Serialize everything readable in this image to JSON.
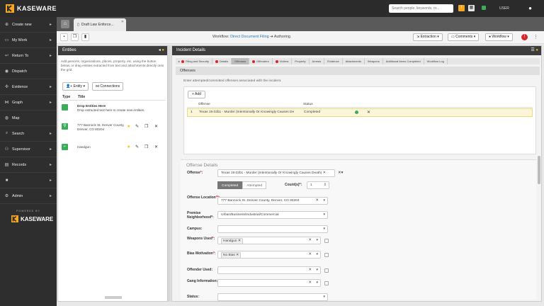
{
  "topbar": {
    "brand": "KASEWARE",
    "search_placeholder": "Search people, keywords, or...",
    "user": "USER"
  },
  "sidebar": {
    "items": [
      {
        "label": "Create new",
        "icon": "plus-icon"
      },
      {
        "label": "My Work",
        "icon": "folder-icon"
      },
      {
        "label": "Return To",
        "icon": "return-icon"
      },
      {
        "label": "Dispatch",
        "icon": "dispatch-icon"
      },
      {
        "label": "Evidence",
        "icon": "evidence-icon"
      },
      {
        "label": "Graph",
        "icon": "graph-icon"
      },
      {
        "label": "Map",
        "icon": "map-icon"
      },
      {
        "label": "Search",
        "icon": "search-icon"
      },
      {
        "label": "Supervisor",
        "icon": "supervisor-icon"
      },
      {
        "label": "Records",
        "icon": "records-icon"
      },
      {
        "label": "",
        "icon": "box-icon"
      },
      {
        "label": "Admin",
        "icon": "gear-icon"
      }
    ],
    "powered_by": "POWERED BY",
    "brand": "KASEWARE"
  },
  "tabs": {
    "doc_tab": "Draft Law Enforce..."
  },
  "toolbar": {
    "workflow_prefix": "Workflow:",
    "workflow_link": "Direct Document Filing",
    "workflow_arrow": "➔",
    "workflow_state": "Authoring",
    "extraction": "Extraction",
    "comments": "Comments",
    "workflow": "Workflow"
  },
  "entities": {
    "title": "Entities",
    "description": "Add persons, organizations, places, property, etc. using the button below, or drag entities extracted from text and attachments directly onto the grid.",
    "entity_btn": "Entity",
    "connections_btn": "Connections",
    "col_type": "Type",
    "col_title": "Title",
    "drop_title": "Drop Entities Here",
    "drop_desc": "Drop extracted text here to create new entities.",
    "rows": [
      {
        "title": "777 Bannock St. Denver County, Denver, CO 80204"
      },
      {
        "title": "Handgun"
      }
    ]
  },
  "incident": {
    "title": "Incident Details",
    "steps": [
      {
        "label": "Filing and Security",
        "error": true
      },
      {
        "label": "Details",
        "error": true
      },
      {
        "label": "Offenses",
        "error": false,
        "active": true
      },
      {
        "label": "Offenders",
        "error": true
      },
      {
        "label": "Victims",
        "error": true
      },
      {
        "label": "Property",
        "error": false
      },
      {
        "label": "Arrests",
        "error": false
      },
      {
        "label": "Evidence",
        "error": false
      },
      {
        "label": "Attachments",
        "error": false
      },
      {
        "label": "Weapons",
        "error": false
      },
      {
        "label": "Additional Items Completed",
        "error": false
      },
      {
        "label": "Workflow Log",
        "error": false
      }
    ],
    "section": "Offenses",
    "subtitle": "Enter attempted/committed offenses associated with the incident.",
    "add": "Add",
    "col_offense": "Offense",
    "col_status": "Status",
    "row_num": "1",
    "row_offense": "Texas 19.02b1 - Murder (Intentionally Or Knowingly Causes De",
    "row_status": "Completed"
  },
  "details": {
    "title": "Offense Details",
    "offense_label": "Offense",
    "offense_value": "Texas 19.02b1 - Murder (Intentionally Or Knowingly Causes Death)",
    "completed": "Completed",
    "attempted": "Attempted",
    "count_label": "Count(s)*:",
    "count_value": "1",
    "location_label": "Offense Location",
    "location_value": "777 Bannock St. Denver County, Denver, CO 80204",
    "premise_label": "Premise Neighborhood*:",
    "premise_value": "Urban/Business/Industrial/Commercial",
    "campus_label": "Campus:",
    "weapons_label": "Weapons Used",
    "weapons_value": "Handgun",
    "bias_label": "Bias Motivation",
    "bias_value": "No Bias",
    "offender_used_label": "Offender Used:",
    "gang_label": "Gang Information:",
    "status_label": "Status:"
  }
}
